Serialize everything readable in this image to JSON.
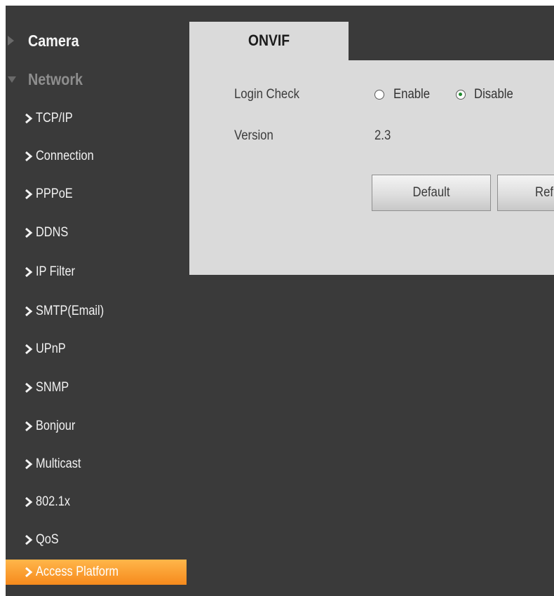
{
  "sidebar": {
    "sections": [
      {
        "label": "Camera",
        "expanded": false
      },
      {
        "label": "Network",
        "expanded": true
      }
    ],
    "items": [
      {
        "label": "TCP/IP",
        "active": false
      },
      {
        "label": "Connection",
        "active": false
      },
      {
        "label": "PPPoE",
        "active": false
      },
      {
        "label": "DDNS",
        "active": false
      },
      {
        "label": "IP Filter",
        "active": false
      },
      {
        "label": "SMTP(Email)",
        "active": false
      },
      {
        "label": "UPnP",
        "active": false
      },
      {
        "label": "SNMP",
        "active": false
      },
      {
        "label": "Bonjour",
        "active": false
      },
      {
        "label": "Multicast",
        "active": false
      },
      {
        "label": "802.1x",
        "active": false
      },
      {
        "label": "QoS",
        "active": false
      },
      {
        "label": "Access Platform",
        "active": true
      }
    ],
    "active_color": "#f68a1d"
  },
  "main": {
    "tab": {
      "label": "ONVIF"
    },
    "login_check": {
      "label": "Login Check",
      "options": [
        {
          "label": "Enable",
          "selected": false
        },
        {
          "label": "Disable",
          "selected": true
        }
      ]
    },
    "version": {
      "label": "Version",
      "value": "2.3"
    },
    "buttons": {
      "default_label": "Default",
      "refresh_label": "Refresh"
    }
  },
  "icons": {
    "section_collapsed": "triangle-right-icon",
    "section_expanded": "triangle-down-icon",
    "nav_item": "chevron-right-icon"
  },
  "colors": {
    "background": "#3a3a3a",
    "panel": "#dadada",
    "accent": "#f68a1d",
    "radio_selected": "#1f8a2e"
  }
}
